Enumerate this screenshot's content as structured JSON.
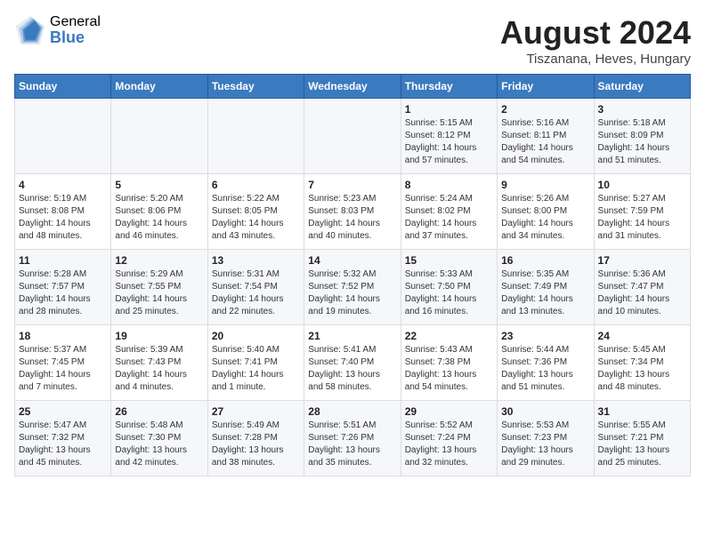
{
  "logo": {
    "general": "General",
    "blue": "Blue"
  },
  "title": "August 2024",
  "location": "Tiszanana, Heves, Hungary",
  "weekdays": [
    "Sunday",
    "Monday",
    "Tuesday",
    "Wednesday",
    "Thursday",
    "Friday",
    "Saturday"
  ],
  "weeks": [
    [
      {
        "day": "",
        "sunrise": "",
        "sunset": "",
        "daylight": ""
      },
      {
        "day": "",
        "sunrise": "",
        "sunset": "",
        "daylight": ""
      },
      {
        "day": "",
        "sunrise": "",
        "sunset": "",
        "daylight": ""
      },
      {
        "day": "",
        "sunrise": "",
        "sunset": "",
        "daylight": ""
      },
      {
        "day": "1",
        "sunrise": "Sunrise: 5:15 AM",
        "sunset": "Sunset: 8:12 PM",
        "daylight": "Daylight: 14 hours and 57 minutes."
      },
      {
        "day": "2",
        "sunrise": "Sunrise: 5:16 AM",
        "sunset": "Sunset: 8:11 PM",
        "daylight": "Daylight: 14 hours and 54 minutes."
      },
      {
        "day": "3",
        "sunrise": "Sunrise: 5:18 AM",
        "sunset": "Sunset: 8:09 PM",
        "daylight": "Daylight: 14 hours and 51 minutes."
      }
    ],
    [
      {
        "day": "4",
        "sunrise": "Sunrise: 5:19 AM",
        "sunset": "Sunset: 8:08 PM",
        "daylight": "Daylight: 14 hours and 48 minutes."
      },
      {
        "day": "5",
        "sunrise": "Sunrise: 5:20 AM",
        "sunset": "Sunset: 8:06 PM",
        "daylight": "Daylight: 14 hours and 46 minutes."
      },
      {
        "day": "6",
        "sunrise": "Sunrise: 5:22 AM",
        "sunset": "Sunset: 8:05 PM",
        "daylight": "Daylight: 14 hours and 43 minutes."
      },
      {
        "day": "7",
        "sunrise": "Sunrise: 5:23 AM",
        "sunset": "Sunset: 8:03 PM",
        "daylight": "Daylight: 14 hours and 40 minutes."
      },
      {
        "day": "8",
        "sunrise": "Sunrise: 5:24 AM",
        "sunset": "Sunset: 8:02 PM",
        "daylight": "Daylight: 14 hours and 37 minutes."
      },
      {
        "day": "9",
        "sunrise": "Sunrise: 5:26 AM",
        "sunset": "Sunset: 8:00 PM",
        "daylight": "Daylight: 14 hours and 34 minutes."
      },
      {
        "day": "10",
        "sunrise": "Sunrise: 5:27 AM",
        "sunset": "Sunset: 7:59 PM",
        "daylight": "Daylight: 14 hours and 31 minutes."
      }
    ],
    [
      {
        "day": "11",
        "sunrise": "Sunrise: 5:28 AM",
        "sunset": "Sunset: 7:57 PM",
        "daylight": "Daylight: 14 hours and 28 minutes."
      },
      {
        "day": "12",
        "sunrise": "Sunrise: 5:29 AM",
        "sunset": "Sunset: 7:55 PM",
        "daylight": "Daylight: 14 hours and 25 minutes."
      },
      {
        "day": "13",
        "sunrise": "Sunrise: 5:31 AM",
        "sunset": "Sunset: 7:54 PM",
        "daylight": "Daylight: 14 hours and 22 minutes."
      },
      {
        "day": "14",
        "sunrise": "Sunrise: 5:32 AM",
        "sunset": "Sunset: 7:52 PM",
        "daylight": "Daylight: 14 hours and 19 minutes."
      },
      {
        "day": "15",
        "sunrise": "Sunrise: 5:33 AM",
        "sunset": "Sunset: 7:50 PM",
        "daylight": "Daylight: 14 hours and 16 minutes."
      },
      {
        "day": "16",
        "sunrise": "Sunrise: 5:35 AM",
        "sunset": "Sunset: 7:49 PM",
        "daylight": "Daylight: 14 hours and 13 minutes."
      },
      {
        "day": "17",
        "sunrise": "Sunrise: 5:36 AM",
        "sunset": "Sunset: 7:47 PM",
        "daylight": "Daylight: 14 hours and 10 minutes."
      }
    ],
    [
      {
        "day": "18",
        "sunrise": "Sunrise: 5:37 AM",
        "sunset": "Sunset: 7:45 PM",
        "daylight": "Daylight: 14 hours and 7 minutes."
      },
      {
        "day": "19",
        "sunrise": "Sunrise: 5:39 AM",
        "sunset": "Sunset: 7:43 PM",
        "daylight": "Daylight: 14 hours and 4 minutes."
      },
      {
        "day": "20",
        "sunrise": "Sunrise: 5:40 AM",
        "sunset": "Sunset: 7:41 PM",
        "daylight": "Daylight: 14 hours and 1 minute."
      },
      {
        "day": "21",
        "sunrise": "Sunrise: 5:41 AM",
        "sunset": "Sunset: 7:40 PM",
        "daylight": "Daylight: 13 hours and 58 minutes."
      },
      {
        "day": "22",
        "sunrise": "Sunrise: 5:43 AM",
        "sunset": "Sunset: 7:38 PM",
        "daylight": "Daylight: 13 hours and 54 minutes."
      },
      {
        "day": "23",
        "sunrise": "Sunrise: 5:44 AM",
        "sunset": "Sunset: 7:36 PM",
        "daylight": "Daylight: 13 hours and 51 minutes."
      },
      {
        "day": "24",
        "sunrise": "Sunrise: 5:45 AM",
        "sunset": "Sunset: 7:34 PM",
        "daylight": "Daylight: 13 hours and 48 minutes."
      }
    ],
    [
      {
        "day": "25",
        "sunrise": "Sunrise: 5:47 AM",
        "sunset": "Sunset: 7:32 PM",
        "daylight": "Daylight: 13 hours and 45 minutes."
      },
      {
        "day": "26",
        "sunrise": "Sunrise: 5:48 AM",
        "sunset": "Sunset: 7:30 PM",
        "daylight": "Daylight: 13 hours and 42 minutes."
      },
      {
        "day": "27",
        "sunrise": "Sunrise: 5:49 AM",
        "sunset": "Sunset: 7:28 PM",
        "daylight": "Daylight: 13 hours and 38 minutes."
      },
      {
        "day": "28",
        "sunrise": "Sunrise: 5:51 AM",
        "sunset": "Sunset: 7:26 PM",
        "daylight": "Daylight: 13 hours and 35 minutes."
      },
      {
        "day": "29",
        "sunrise": "Sunrise: 5:52 AM",
        "sunset": "Sunset: 7:24 PM",
        "daylight": "Daylight: 13 hours and 32 minutes."
      },
      {
        "day": "30",
        "sunrise": "Sunrise: 5:53 AM",
        "sunset": "Sunset: 7:23 PM",
        "daylight": "Daylight: 13 hours and 29 minutes."
      },
      {
        "day": "31",
        "sunrise": "Sunrise: 5:55 AM",
        "sunset": "Sunset: 7:21 PM",
        "daylight": "Daylight: 13 hours and 25 minutes."
      }
    ]
  ]
}
